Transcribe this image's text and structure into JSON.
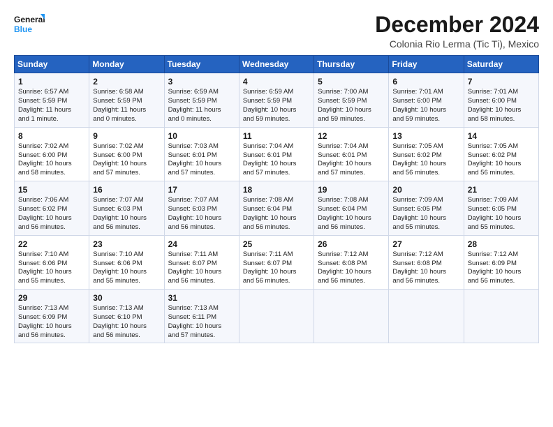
{
  "header": {
    "logo_line1": "General",
    "logo_line2": "Blue",
    "month": "December 2024",
    "location": "Colonia Rio Lerma (Tic Ti), Mexico"
  },
  "days_of_week": [
    "Sunday",
    "Monday",
    "Tuesday",
    "Wednesday",
    "Thursday",
    "Friday",
    "Saturday"
  ],
  "weeks": [
    [
      {
        "day": "1",
        "info": "Sunrise: 6:57 AM\nSunset: 5:59 PM\nDaylight: 11 hours\nand 1 minute."
      },
      {
        "day": "2",
        "info": "Sunrise: 6:58 AM\nSunset: 5:59 PM\nDaylight: 11 hours\nand 0 minutes."
      },
      {
        "day": "3",
        "info": "Sunrise: 6:59 AM\nSunset: 5:59 PM\nDaylight: 11 hours\nand 0 minutes."
      },
      {
        "day": "4",
        "info": "Sunrise: 6:59 AM\nSunset: 5:59 PM\nDaylight: 10 hours\nand 59 minutes."
      },
      {
        "day": "5",
        "info": "Sunrise: 7:00 AM\nSunset: 5:59 PM\nDaylight: 10 hours\nand 59 minutes."
      },
      {
        "day": "6",
        "info": "Sunrise: 7:01 AM\nSunset: 6:00 PM\nDaylight: 10 hours\nand 59 minutes."
      },
      {
        "day": "7",
        "info": "Sunrise: 7:01 AM\nSunset: 6:00 PM\nDaylight: 10 hours\nand 58 minutes."
      }
    ],
    [
      {
        "day": "8",
        "info": "Sunrise: 7:02 AM\nSunset: 6:00 PM\nDaylight: 10 hours\nand 58 minutes."
      },
      {
        "day": "9",
        "info": "Sunrise: 7:02 AM\nSunset: 6:00 PM\nDaylight: 10 hours\nand 57 minutes."
      },
      {
        "day": "10",
        "info": "Sunrise: 7:03 AM\nSunset: 6:01 PM\nDaylight: 10 hours\nand 57 minutes."
      },
      {
        "day": "11",
        "info": "Sunrise: 7:04 AM\nSunset: 6:01 PM\nDaylight: 10 hours\nand 57 minutes."
      },
      {
        "day": "12",
        "info": "Sunrise: 7:04 AM\nSunset: 6:01 PM\nDaylight: 10 hours\nand 57 minutes."
      },
      {
        "day": "13",
        "info": "Sunrise: 7:05 AM\nSunset: 6:02 PM\nDaylight: 10 hours\nand 56 minutes."
      },
      {
        "day": "14",
        "info": "Sunrise: 7:05 AM\nSunset: 6:02 PM\nDaylight: 10 hours\nand 56 minutes."
      }
    ],
    [
      {
        "day": "15",
        "info": "Sunrise: 7:06 AM\nSunset: 6:02 PM\nDaylight: 10 hours\nand 56 minutes."
      },
      {
        "day": "16",
        "info": "Sunrise: 7:07 AM\nSunset: 6:03 PM\nDaylight: 10 hours\nand 56 minutes."
      },
      {
        "day": "17",
        "info": "Sunrise: 7:07 AM\nSunset: 6:03 PM\nDaylight: 10 hours\nand 56 minutes."
      },
      {
        "day": "18",
        "info": "Sunrise: 7:08 AM\nSunset: 6:04 PM\nDaylight: 10 hours\nand 56 minutes."
      },
      {
        "day": "19",
        "info": "Sunrise: 7:08 AM\nSunset: 6:04 PM\nDaylight: 10 hours\nand 56 minutes."
      },
      {
        "day": "20",
        "info": "Sunrise: 7:09 AM\nSunset: 6:05 PM\nDaylight: 10 hours\nand 55 minutes."
      },
      {
        "day": "21",
        "info": "Sunrise: 7:09 AM\nSunset: 6:05 PM\nDaylight: 10 hours\nand 55 minutes."
      }
    ],
    [
      {
        "day": "22",
        "info": "Sunrise: 7:10 AM\nSunset: 6:06 PM\nDaylight: 10 hours\nand 55 minutes."
      },
      {
        "day": "23",
        "info": "Sunrise: 7:10 AM\nSunset: 6:06 PM\nDaylight: 10 hours\nand 55 minutes."
      },
      {
        "day": "24",
        "info": "Sunrise: 7:11 AM\nSunset: 6:07 PM\nDaylight: 10 hours\nand 56 minutes."
      },
      {
        "day": "25",
        "info": "Sunrise: 7:11 AM\nSunset: 6:07 PM\nDaylight: 10 hours\nand 56 minutes."
      },
      {
        "day": "26",
        "info": "Sunrise: 7:12 AM\nSunset: 6:08 PM\nDaylight: 10 hours\nand 56 minutes."
      },
      {
        "day": "27",
        "info": "Sunrise: 7:12 AM\nSunset: 6:08 PM\nDaylight: 10 hours\nand 56 minutes."
      },
      {
        "day": "28",
        "info": "Sunrise: 7:12 AM\nSunset: 6:09 PM\nDaylight: 10 hours\nand 56 minutes."
      }
    ],
    [
      {
        "day": "29",
        "info": "Sunrise: 7:13 AM\nSunset: 6:09 PM\nDaylight: 10 hours\nand 56 minutes."
      },
      {
        "day": "30",
        "info": "Sunrise: 7:13 AM\nSunset: 6:10 PM\nDaylight: 10 hours\nand 56 minutes."
      },
      {
        "day": "31",
        "info": "Sunrise: 7:13 AM\nSunset: 6:11 PM\nDaylight: 10 hours\nand 57 minutes."
      },
      {
        "day": "",
        "info": ""
      },
      {
        "day": "",
        "info": ""
      },
      {
        "day": "",
        "info": ""
      },
      {
        "day": "",
        "info": ""
      }
    ]
  ]
}
